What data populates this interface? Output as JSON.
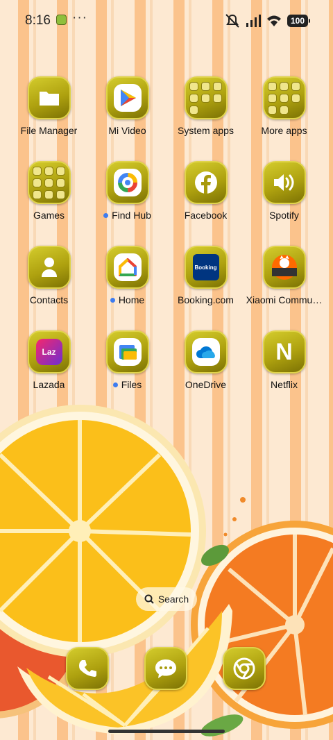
{
  "status": {
    "time": "8:16",
    "dots": "···",
    "battery": "100"
  },
  "rows": [
    [
      {
        "label": "File Manager",
        "icon": "folder-icon",
        "dot": false
      },
      {
        "label": "Mi Video",
        "icon": "play-icon",
        "dot": false
      },
      {
        "label": "System apps",
        "icon": "folder-group-icon",
        "dot": false
      },
      {
        "label": "More apps",
        "icon": "folder-group-icon",
        "dot": false
      }
    ],
    [
      {
        "label": "Games",
        "icon": "folder-group-icon",
        "dot": false
      },
      {
        "label": "Find Hub",
        "icon": "find-hub-icon",
        "dot": true
      },
      {
        "label": "Facebook",
        "icon": "facebook-icon",
        "dot": false
      },
      {
        "label": "Spotify",
        "icon": "speaker-icon",
        "dot": false
      }
    ],
    [
      {
        "label": "Contacts",
        "icon": "person-icon",
        "dot": false
      },
      {
        "label": "Home",
        "icon": "home-icon",
        "dot": true
      },
      {
        "label": "Booking.com",
        "icon": "booking-icon",
        "dot": false
      },
      {
        "label": "Xiaomi Commu…",
        "icon": "xiaomi-community-icon",
        "dot": false
      }
    ],
    [
      {
        "label": "Lazada",
        "icon": "lazada-icon",
        "dot": false
      },
      {
        "label": "Files",
        "icon": "files-icon",
        "dot": true
      },
      {
        "label": "OneDrive",
        "icon": "cloud-icon",
        "dot": false
      },
      {
        "label": "Netflix",
        "icon": "netflix-icon",
        "dot": false
      }
    ]
  ],
  "icon_text": {
    "booking": "Booking",
    "lazada": "Laz",
    "netflix": "N"
  },
  "search": {
    "label": "Search"
  },
  "dock": [
    {
      "icon": "phone-icon"
    },
    {
      "icon": "message-icon"
    },
    {
      "icon": "chrome-icon"
    }
  ],
  "colors": {
    "tile": "#b3a612",
    "dot": "#3d7cf0",
    "stripe": "#fbc38c"
  }
}
